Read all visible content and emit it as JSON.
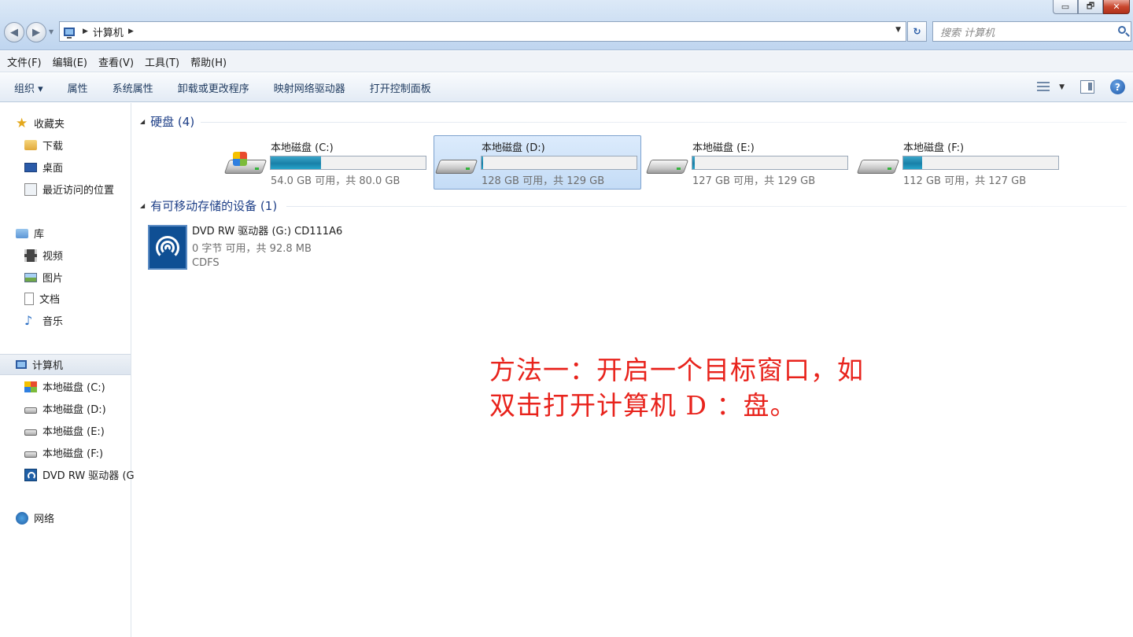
{
  "window": {
    "controls": {
      "minimize": "▭",
      "restore": "🗗",
      "close": "✕"
    }
  },
  "address": {
    "crumbs": [
      "计算机"
    ],
    "search_placeholder": "搜索 计算机"
  },
  "menubar": [
    {
      "label": "文件(F)"
    },
    {
      "label": "编辑(E)"
    },
    {
      "label": "查看(V)"
    },
    {
      "label": "工具(T)"
    },
    {
      "label": "帮助(H)"
    }
  ],
  "toolbar": {
    "organize": "组织 ▾",
    "items": [
      "属性",
      "系统属性",
      "卸载或更改程序",
      "映射网络驱动器",
      "打开控制面板"
    ]
  },
  "navpane": {
    "favorites": {
      "label": "收藏夹",
      "items": [
        "下载",
        "桌面",
        "最近访问的位置"
      ]
    },
    "libraries": {
      "label": "库",
      "items": [
        "视频",
        "图片",
        "文档",
        "音乐"
      ]
    },
    "computer": {
      "label": "计算机",
      "items": [
        "本地磁盘 (C:)",
        "本地磁盘 (D:)",
        "本地磁盘 (E:)",
        "本地磁盘 (F:)",
        "DVD RW 驱动器 (G"
      ]
    },
    "network": {
      "label": "网络"
    }
  },
  "content": {
    "hard_disks_header": "硬盘 (4)",
    "drives": [
      {
        "name": "本地磁盘 (C:)",
        "info": "54.0 GB 可用，共 80.0 GB",
        "used_fraction": 0.325,
        "selected": false,
        "system": true
      },
      {
        "name": "本地磁盘 (D:)",
        "info": "128 GB 可用，共 129 GB",
        "used_fraction": 0.008,
        "selected": true,
        "system": false
      },
      {
        "name": "本地磁盘 (E:)",
        "info": "127 GB 可用，共 129 GB",
        "used_fraction": 0.016,
        "selected": false,
        "system": false
      },
      {
        "name": "本地磁盘 (F:)",
        "info": "112 GB 可用，共 127 GB",
        "used_fraction": 0.12,
        "selected": false,
        "system": false
      }
    ],
    "removable_header": "有可移动存储的设备 (1)",
    "dvd": {
      "name": "DVD RW 驱动器 (G:) CD111A6",
      "info": "0 字节 可用，共 92.8 MB",
      "fs": "CDFS"
    }
  },
  "annotation": {
    "line1": "方法一：开启一个目标窗口，如",
    "line2": "双击打开计算机 D ：盘。"
  }
}
